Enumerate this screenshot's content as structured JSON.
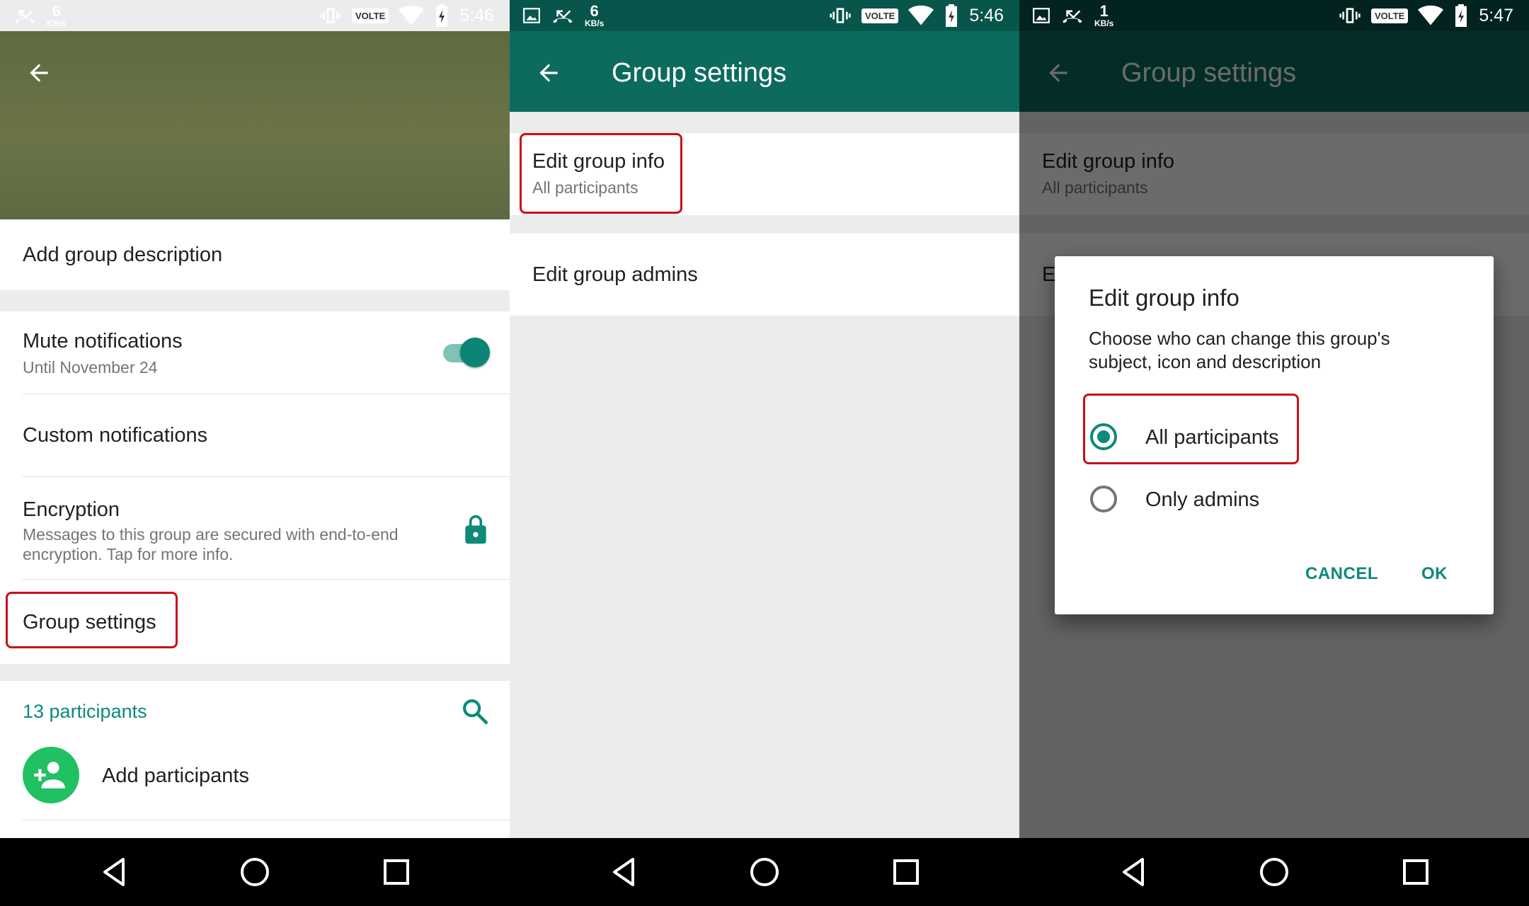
{
  "status_bars": [
    {
      "speed_value": "6",
      "speed_unit": "KB/s",
      "network": "VOLTE",
      "time": "5:46"
    },
    {
      "speed_value": "6",
      "speed_unit": "KB/s",
      "network": "VOLTE",
      "time": "5:46"
    },
    {
      "speed_value": "1",
      "speed_unit": "KB/s",
      "network": "VOLTE",
      "time": "5:47"
    }
  ],
  "group_info": {
    "description_prompt": "Add group description",
    "mute": {
      "label": "Mute notifications",
      "sublabel": "Until November 24",
      "enabled": true
    },
    "custom_notifications": "Custom notifications",
    "encryption": {
      "label": "Encryption",
      "message_line1": "Messages to this group are secured with end-to-end",
      "message_line2": "encryption. Tap for more info."
    },
    "group_settings": "Group settings",
    "participants_count": "13 participants",
    "add_participants": "Add participants"
  },
  "group_settings": {
    "title": "Group settings",
    "edit_info": {
      "label": "Edit group info",
      "value": "All participants"
    },
    "edit_admins": "Edit group admins",
    "edit_admins_partial": "E"
  },
  "dialog": {
    "title": "Edit group info",
    "message_line1": "Choose who can change this group's",
    "message_line2": "subject, icon and description",
    "options": [
      "All participants",
      "Only admins"
    ],
    "selected_option": "All participants",
    "cancel": "CANCEL",
    "ok": "OK"
  },
  "colors": {
    "teal_dark": "#0d6b5e",
    "accent": "#0d8a7a",
    "highlight_box": "#c8101a",
    "add_button": "#21c063"
  }
}
